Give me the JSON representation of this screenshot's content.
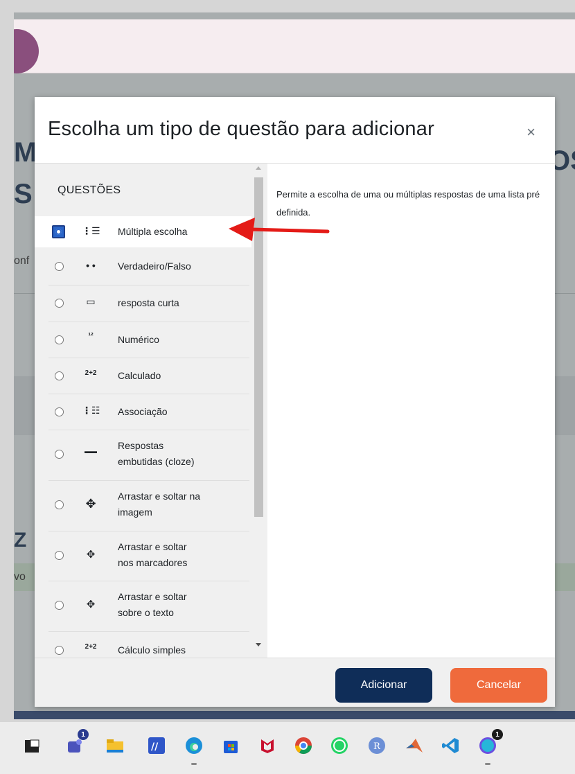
{
  "modal": {
    "title": "Escolha um tipo de questão para adicionar",
    "close_glyph": "×",
    "section_label": "QUESTÕES",
    "description": "Permite a escolha de uma ou múltiplas respostas de uma lista pré definida.",
    "options": [
      {
        "label": "Múltipla escolha",
        "icon": "list-icon",
        "glyph": "⋮☰",
        "selected": true
      },
      {
        "label": "Verdadeiro/Falso",
        "icon": "true-false-icon",
        "glyph": "• •",
        "selected": false
      },
      {
        "label": "resposta curta",
        "icon": "short-answer-icon",
        "glyph": "▭",
        "selected": false
      },
      {
        "label": "Numérico",
        "icon": "numeric-icon",
        "glyph": "¹²",
        "selected": false
      },
      {
        "label": "Calculado",
        "icon": "calculated-icon",
        "glyph": "2+2",
        "selected": false
      },
      {
        "label": "Associação",
        "icon": "matching-icon",
        "glyph": "⋮☷",
        "selected": false
      },
      {
        "label_line1": "Respostas",
        "label_line2": "embutidas (cloze)",
        "icon": "cloze-icon",
        "glyph": "▬▬",
        "selected": false
      },
      {
        "label_line1": "Arrastar e soltar na",
        "label_line2": "imagem",
        "icon": "drag-drop-image-icon",
        "glyph": "✥",
        "selected": false
      },
      {
        "label_line1": "Arrastar e soltar",
        "label_line2": "nos marcadores",
        "icon": "drag-drop-markers-icon",
        "glyph": "✥",
        "selected": false
      },
      {
        "label_line1": "Arrastar e soltar",
        "label_line2": "sobre o texto",
        "icon": "drag-drop-text-icon",
        "glyph": "✥",
        "selected": false
      },
      {
        "label": "Cálculo simples",
        "icon": "simple-calculated-icon",
        "glyph": "2+2",
        "selected": false
      }
    ],
    "buttons": {
      "add": "Adicionar",
      "cancel": "Cancelar"
    }
  },
  "background": {
    "frag_m": "M",
    "frag_s": "S",
    "frag_os": "OS",
    "frag_z": "Z",
    "frag_onf": "onf",
    "frag_vo": "vo"
  },
  "taskbar": {
    "badges": {
      "teams": "1",
      "canva": "1"
    }
  },
  "colors": {
    "primary_button": "#0f2d58",
    "cancel_button": "#ef6a3c",
    "arrow": "#e41b17",
    "selected_radio": "#2a65c8"
  }
}
